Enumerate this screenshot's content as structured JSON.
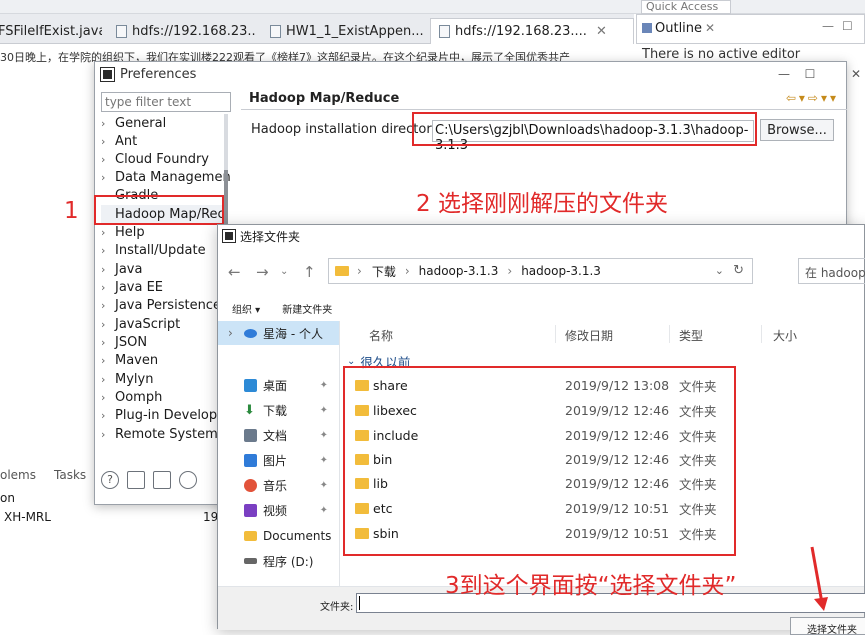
{
  "eclipse": {
    "editor_tabs": [
      {
        "label": "FSFileIfExist.java"
      },
      {
        "label": "hdfs://192.168.23...."
      },
      {
        "label": "HW1_1_ExistAppen..."
      },
      {
        "label": "hdfs://192.168.23...."
      }
    ],
    "quick_access": "Quick Access",
    "outline_tab": "Outline",
    "outline_message": "There is no active editor",
    "editor_text": "30日晚上，在学院的组织下，我们在实训楼222观看了《榜样7》这部纪录片。在这个纪录片中，展示了全国优秀共产",
    "bottom_tabs": [
      "olems",
      "Tasks"
    ],
    "bottom_col": "on",
    "bottom_row": "XH-MRL",
    "bottom_row_value": "19"
  },
  "preferences": {
    "title": "Preferences",
    "filter_placeholder": "type filter text",
    "tree_items": [
      {
        "label": "General",
        "expand": true
      },
      {
        "label": "Ant",
        "expand": true
      },
      {
        "label": "Cloud Foundry",
        "expand": true
      },
      {
        "label": "Data Managemen",
        "expand": true
      },
      {
        "label": "Gradle",
        "expand": false
      },
      {
        "label": "Hadoop Map/Rec",
        "expand": false
      },
      {
        "label": "Help",
        "expand": true
      },
      {
        "label": "Install/Update",
        "expand": true
      },
      {
        "label": "Java",
        "expand": true
      },
      {
        "label": "Java EE",
        "expand": true
      },
      {
        "label": "Java Persistence",
        "expand": true
      },
      {
        "label": "JavaScript",
        "expand": true
      },
      {
        "label": "JSON",
        "expand": true
      },
      {
        "label": "Maven",
        "expand": true
      },
      {
        "label": "Mylyn",
        "expand": true
      },
      {
        "label": "Oomph",
        "expand": true
      },
      {
        "label": "Plug-in Developm",
        "expand": true
      },
      {
        "label": "Remote Systems",
        "expand": true
      }
    ],
    "page_heading": "Hadoop Map/Reduce",
    "install_dir_label": "Hadoop installation directory:",
    "install_dir_value": "C:\\Users\\gzjbl\\Downloads\\hadoop-3.1.3\\hadoop-3.1.3",
    "browse_label": "Browse..."
  },
  "annotations": {
    "step1": "1",
    "step2": "2  选择刚刚解压的文件夹",
    "step3": "3到这个界面按“选择文件夹”",
    "color": "#e12a2a"
  },
  "file_dialog": {
    "title": "选择文件夹",
    "breadcrumb": [
      "下载",
      "hadoop-3.1.3",
      "hadoop-3.1.3"
    ],
    "search_placeholder": "在 hadoop",
    "organize_label": "组织 ▾",
    "new_folder_label": "新建文件夹",
    "nav_items": [
      {
        "label": "星海 - 个人",
        "icon": "cloud-icon",
        "color": "#2f7bd8"
      },
      {
        "label": "桌面",
        "icon": "desktop-icon",
        "color": "#2d8ad6"
      },
      {
        "label": "下载",
        "icon": "download-icon",
        "color": "#2b8a3e"
      },
      {
        "label": "文档",
        "icon": "documents-icon",
        "color": "#6b7a8c"
      },
      {
        "label": "图片",
        "icon": "pictures-icon",
        "color": "#2f7bd8"
      },
      {
        "label": "音乐",
        "icon": "music-icon",
        "color": "#e2533a"
      },
      {
        "label": "视频",
        "icon": "videos-icon",
        "color": "#7a3fc2"
      },
      {
        "label": "Documents",
        "icon": "folder-icon",
        "color": "#f2bc3b"
      },
      {
        "label": "程序 (D:)",
        "icon": "drive-icon",
        "color": "#666666"
      }
    ],
    "columns": [
      "名称",
      "修改日期",
      "类型",
      "大小"
    ],
    "group_header": "很久以前",
    "files": [
      {
        "name": "share",
        "date": "2019/9/12 13:08",
        "type": "文件夹"
      },
      {
        "name": "libexec",
        "date": "2019/9/12 12:46",
        "type": "文件夹"
      },
      {
        "name": "include",
        "date": "2019/9/12 12:46",
        "type": "文件夹"
      },
      {
        "name": "bin",
        "date": "2019/9/12 12:46",
        "type": "文件夹"
      },
      {
        "name": "lib",
        "date": "2019/9/12 12:46",
        "type": "文件夹"
      },
      {
        "name": "etc",
        "date": "2019/9/12 10:51",
        "type": "文件夹"
      },
      {
        "name": "sbin",
        "date": "2019/9/12 10:51",
        "type": "文件夹"
      }
    ],
    "filename_label": "文件夹:",
    "filename_value": "",
    "select_button": "选择文件夹"
  }
}
